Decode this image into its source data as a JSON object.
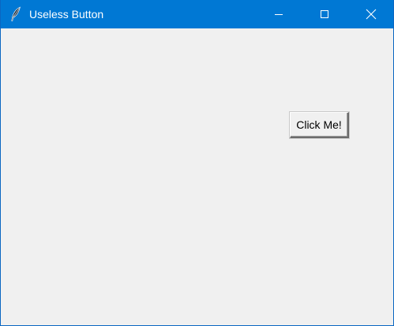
{
  "window": {
    "title": "Useless Button",
    "titlebar_color": "#0078d4",
    "client_background": "#f0f0f0",
    "app_icon": "feather-icon",
    "controls": {
      "minimize_icon": "minimize-icon",
      "maximize_icon": "maximize-icon",
      "close_icon": "close-icon"
    }
  },
  "main": {
    "button_label": "Click Me!"
  }
}
